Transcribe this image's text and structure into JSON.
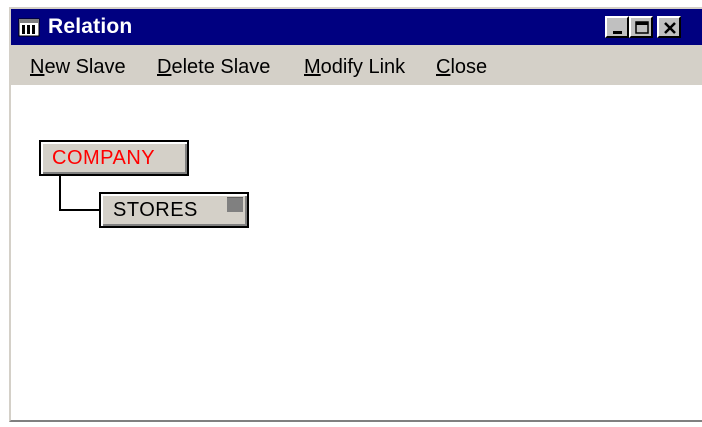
{
  "window": {
    "title": "Relation",
    "icon": "app-window-icon",
    "controls": [
      "minimize-icon",
      "maximize-icon",
      "close-icon"
    ]
  },
  "menu": {
    "new_slave": {
      "hotkey": "N",
      "rest": "ew Slave"
    },
    "delete_slave": {
      "hotkey": "D",
      "rest": "elete Slave"
    },
    "modify_link": {
      "hotkey": "M",
      "rest": "odify Link"
    },
    "close": {
      "hotkey": "C",
      "rest": "lose"
    }
  },
  "tree": {
    "master": {
      "label": "COMPANY",
      "color": "#ff0000"
    },
    "slave": {
      "label": "STORES",
      "color": "#000000"
    }
  },
  "colors": {
    "titlebar": "#000080",
    "menubar": "#d4d0c8",
    "node_face": "#d4d0c8"
  }
}
